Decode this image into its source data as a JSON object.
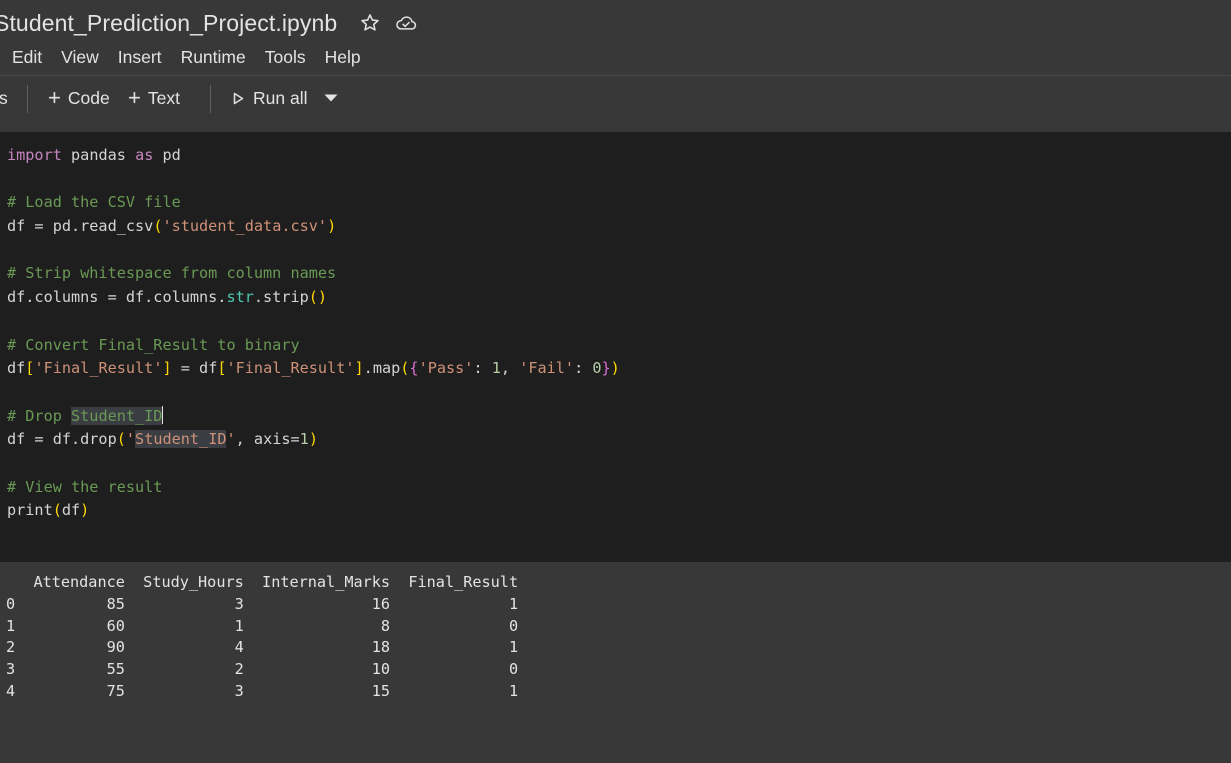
{
  "notebook": {
    "title": "Student_Prediction_Project.ipynb",
    "star_icon": "star-icon",
    "cloud_icon": "cloud-saved-icon"
  },
  "menu": [
    "Edit",
    "View",
    "Insert",
    "Runtime",
    "Tools",
    "Help"
  ],
  "toolbar": {
    "left_fragment": "s",
    "code_label": "Code",
    "text_label": "Text",
    "run_all_label": "Run all",
    "run_icon": "play-icon",
    "dropdown_icon": "caret-down-icon"
  },
  "code_lines": [
    [
      [
        "kw",
        "import"
      ],
      [
        "",
        "pandas"
      ],
      [
        "kw",
        "as"
      ],
      [
        "",
        "pd"
      ]
    ],
    [],
    [
      [
        "cm",
        "# Load the CSV file"
      ]
    ],
    [
      [
        "",
        "df = pd.read_csv"
      ],
      [
        "p1",
        "("
      ],
      [
        "st",
        "'student_data.csv'"
      ],
      [
        "p1",
        ")"
      ]
    ],
    [],
    [
      [
        "cm",
        "# Strip whitespace from column names"
      ]
    ],
    [
      [
        "",
        "df.columns = df.columns."
      ],
      [
        "bt",
        "str"
      ],
      [
        "",
        ".strip"
      ],
      [
        "p1",
        "()"
      ]
    ],
    [],
    [
      [
        "cm",
        "# Convert Final_Result to binary"
      ]
    ],
    [
      [
        "",
        "df"
      ],
      [
        "p1",
        "["
      ],
      [
        "st",
        "'Final_Result'"
      ],
      [
        "p1",
        "]"
      ],
      [
        "",
        " = df"
      ],
      [
        "p1",
        "["
      ],
      [
        "st",
        "'Final_Result'"
      ],
      [
        "p1",
        "]"
      ],
      [
        "",
        ".map"
      ],
      [
        "p1",
        "("
      ],
      [
        "p2",
        "{"
      ],
      [
        "st",
        "'Pass'"
      ],
      [
        "",
        ": "
      ],
      [
        "nm",
        "1"
      ],
      [
        "",
        ", "
      ],
      [
        "st",
        "'Fail'"
      ],
      [
        "",
        ": "
      ],
      [
        "nm",
        "0"
      ],
      [
        "p2",
        "}"
      ],
      [
        "p1",
        ")"
      ]
    ],
    [],
    [
      [
        "cm",
        "# Drop "
      ],
      [
        "cm hl",
        "Student_ID"
      ],
      [
        "caret",
        ""
      ]
    ],
    [
      [
        "",
        "df = df.drop"
      ],
      [
        "p1",
        "("
      ],
      [
        "st",
        "'"
      ],
      [
        "st hl",
        "Student_ID"
      ],
      [
        "st",
        "'"
      ],
      [
        "",
        ", axis="
      ],
      [
        "nm",
        "1"
      ],
      [
        "p1",
        ")"
      ]
    ],
    [],
    [
      [
        "cm",
        "# View the result"
      ]
    ],
    [
      [
        "",
        "print"
      ],
      [
        "p1",
        "("
      ],
      [
        "",
        "df"
      ],
      [
        "p1",
        ")"
      ]
    ]
  ],
  "output": {
    "columns": [
      "Attendance",
      "Study_Hours",
      "Internal_Marks",
      "Final_Result"
    ],
    "rows": [
      [
        "0",
        "85",
        "3",
        "16",
        "1"
      ],
      [
        "1",
        "60",
        "1",
        "8",
        "0"
      ],
      [
        "2",
        "90",
        "4",
        "18",
        "1"
      ],
      [
        "3",
        "55",
        "2",
        "10",
        "0"
      ],
      [
        "4",
        "75",
        "3",
        "15",
        "1"
      ]
    ]
  },
  "colors": {
    "app_bg": "#383838",
    "code_bg": "#1e1e1e",
    "keyword": "#c586c0",
    "comment": "#6a9955",
    "string": "#ce9178",
    "number": "#b5cea8",
    "bracket": "#ffd700"
  }
}
